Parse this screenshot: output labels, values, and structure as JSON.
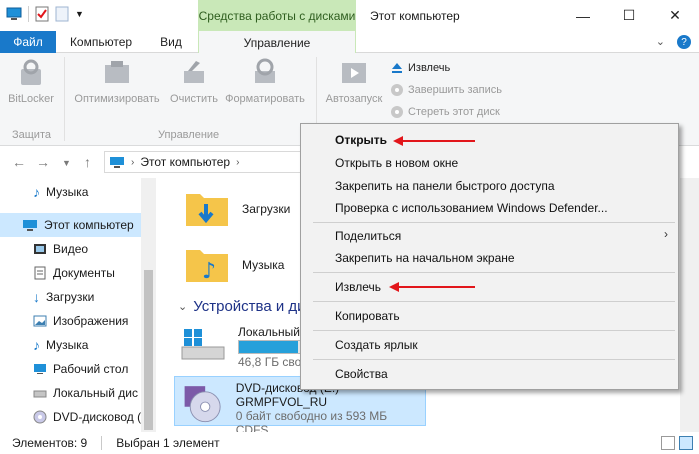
{
  "title_bar": {
    "context_tab_title": "Средства работы с дисками",
    "window_title": "Этот компьютер"
  },
  "ribbon_tabs": {
    "file": "Файл",
    "computer": "Компьютер",
    "view": "Вид",
    "manage": "Управление"
  },
  "ribbon": {
    "bitlocker": "BitLocker",
    "optimize": "Оптимизировать",
    "cleanup": "Очистить",
    "format": "Форматировать",
    "autoplay": "Автозапуск",
    "eject": "Извлечь",
    "finish_burn": "Завершить запись",
    "erase_disc": "Стереть этот диск",
    "group_protect": "Защита",
    "group_manage": "Управление"
  },
  "address": {
    "path": "Этот компьютер"
  },
  "nav_pane": {
    "items": [
      {
        "label": "Музыка",
        "icon": "music-note-icon"
      },
      {
        "label": "Этот компьютер",
        "icon": "computer-icon"
      },
      {
        "label": "Видео",
        "icon": "video-icon"
      },
      {
        "label": "Документы",
        "icon": "documents-icon"
      },
      {
        "label": "Загрузки",
        "icon": "download-icon"
      },
      {
        "label": "Изображения",
        "icon": "pictures-icon"
      },
      {
        "label": "Музыка",
        "icon": "music-note-icon"
      },
      {
        "label": "Рабочий стол",
        "icon": "desktop-icon"
      },
      {
        "label": "Локальный дис",
        "icon": "drive-icon"
      },
      {
        "label": "DVD-дисковод (",
        "icon": "dvd-icon"
      }
    ]
  },
  "main": {
    "folders": [
      {
        "label": "Загрузки"
      },
      {
        "label": "Музыка"
      }
    ],
    "section_header": "Устройства и дис",
    "drives": [
      {
        "name": "Локальный д",
        "free": "46,8 ГБ свобо",
        "fill_fraction": 0.35
      },
      {
        "name": "DVD-дисковод (E:) GRMPFVOL_RU",
        "free": "0 байт свободно из 593 МБ",
        "fs": "CDFS"
      }
    ]
  },
  "context_menu": {
    "open": "Открыть",
    "open_new_window": "Открыть в новом окне",
    "pin_quick_access": "Закрепить на панели быстрого доступа",
    "defender_scan": "Проверка с использованием Windows Defender...",
    "share": "Поделиться",
    "pin_start": "Закрепить на начальном экране",
    "eject": "Извлечь",
    "copy": "Копировать",
    "create_shortcut": "Создать ярлык",
    "properties": "Свойства"
  },
  "status_bar": {
    "items_count": "Элементов: 9",
    "selected": "Выбран 1 элемент"
  },
  "colors": {
    "accent": "#1979ca",
    "context_tab": "#c9e8b8",
    "selection": "#cce8ff",
    "annotation_arrow": "#e2161b"
  }
}
